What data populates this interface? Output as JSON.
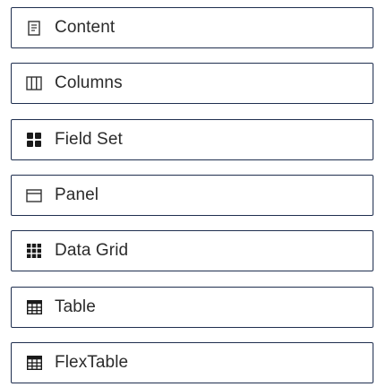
{
  "palette": {
    "items": [
      {
        "label": "Content",
        "icon": "document-icon"
      },
      {
        "label": "Columns",
        "icon": "columns-icon"
      },
      {
        "label": "Field Set",
        "icon": "four-squares-icon"
      },
      {
        "label": "Panel",
        "icon": "panel-icon"
      },
      {
        "label": "Data Grid",
        "icon": "grid-icon"
      },
      {
        "label": "Table",
        "icon": "table-icon"
      },
      {
        "label": "FlexTable",
        "icon": "table-icon"
      }
    ]
  },
  "colors": {
    "border": "#1f2f4f",
    "icon": "#1a1a1a",
    "text": "#2b2b2b",
    "background": "#ffffff"
  }
}
